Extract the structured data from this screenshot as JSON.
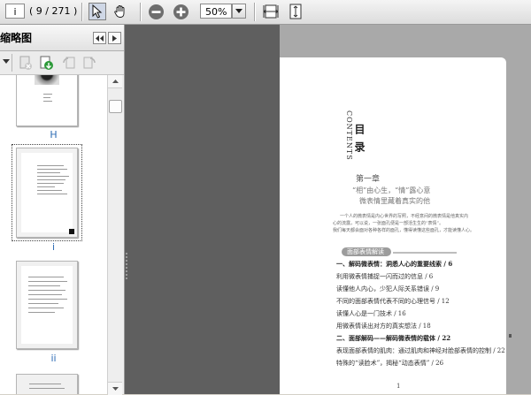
{
  "toolbar": {
    "page_box_value": "i",
    "page_count": "( 9 / 271 )",
    "zoom_value": "50%"
  },
  "sidebar": {
    "title": "缩略图",
    "thumbnails": [
      {
        "label": "H"
      },
      {
        "label": "i"
      },
      {
        "label": "ii"
      }
    ]
  },
  "page": {
    "contents_en": "CONTENTS",
    "contents_zh": "目 录",
    "chapter": "第一章",
    "chapter_title_1": "“相”由心生，“情”露心意",
    "chapter_title_2": "微表情里藏着真实的他",
    "intro_1": "一个人的微表情是内心世界的写照，不经意间的微表情是他真实内",
    "intro_2": "心的流露，可以说，一张面孔便是一部活生生的“表情”。",
    "intro_3": "我们每天都会面对各种各样的面孔，懂得读懂这些面孔，才能读懂人心。",
    "section_badge": "面部表情解读",
    "toc": [
      {
        "text": "一、解码微表情：洞悉人心的重要线索 / 6",
        "bold": true
      },
      {
        "text": "利用微表情捕捉一闪而过的信息 / 6",
        "bold": false
      },
      {
        "text": "读懂他人内心，少犯人际关系错误 / 9",
        "bold": false
      },
      {
        "text": "不同的面部表情代表不同的心理信号 / 12",
        "bold": false
      },
      {
        "text": "读懂人心是一门技术 / 16",
        "bold": false
      },
      {
        "text": "用微表情读出对方的真实想法 / 18",
        "bold": false
      },
      {
        "text": "二、面部解码——解码微表情的载体 / 22",
        "bold": true
      },
      {
        "text": "表现面部表情的肌肉：通过肌肉和神经对脸部表情的控制 / 22",
        "bold": false
      },
      {
        "text": "特殊的“读脸术”，揭秘“动态表情” / 26",
        "bold": false
      }
    ],
    "page_number": "1"
  }
}
